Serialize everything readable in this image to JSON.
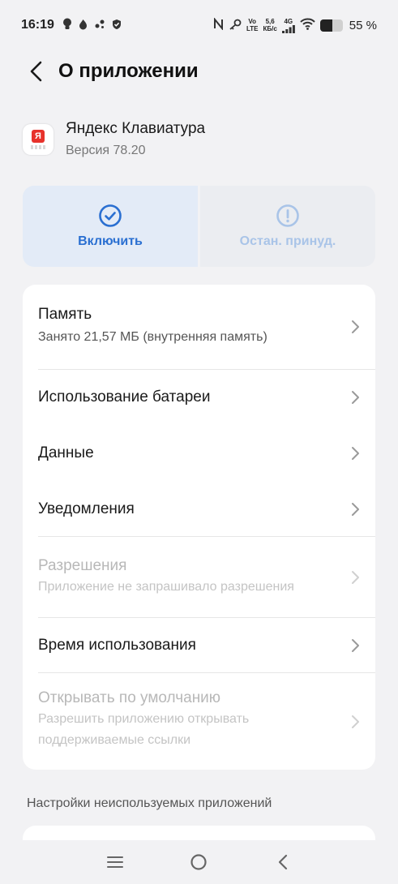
{
  "status_bar": {
    "time": "16:19",
    "volte_top": "Vo",
    "volte_bottom": "LTE",
    "speed_top": "5,6",
    "speed_bottom": "КБ/с",
    "network": "4G",
    "battery_percent": "55 %",
    "battery_level": 0.55
  },
  "header": {
    "title": "О приложении"
  },
  "app": {
    "name": "Яндекс Клавиатура",
    "version": "Версия 78.20",
    "icon_letter": "Я"
  },
  "actions": {
    "enable_label": "Включить",
    "force_stop_label": "Остан. принуд."
  },
  "settings": [
    {
      "title": "Память",
      "subtitle": "Занято 21,57 МБ (внутренняя память)",
      "enabled": true
    },
    {
      "title": "Использование батареи",
      "subtitle": "",
      "enabled": true
    },
    {
      "title": "Данные",
      "subtitle": "",
      "enabled": true
    },
    {
      "title": "Уведомления",
      "subtitle": "",
      "enabled": true
    },
    {
      "title": "Разрешения",
      "subtitle": "Приложение не запрашивало разрешения",
      "enabled": false
    },
    {
      "title": "Время использования",
      "subtitle": "",
      "enabled": true
    },
    {
      "title": "Открывать по умолчанию",
      "subtitle": "Разрешить приложению открывать поддерживаемые ссылки",
      "enabled": false
    }
  ],
  "section": {
    "unused_apps_header": "Настройки неиспользуемых приложений"
  },
  "colors": {
    "accent": "#2a6fd1",
    "accent_disabled": "#a9c4e8",
    "background": "#f2f2f4"
  }
}
